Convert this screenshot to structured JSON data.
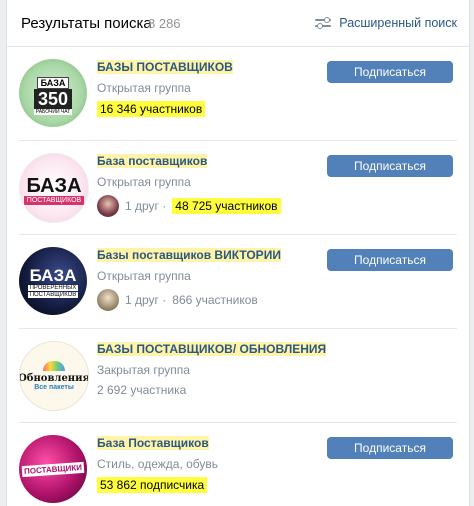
{
  "header": {
    "title": "Результаты поиска",
    "count": "8 286",
    "advanced_label": "Расширенный поиск"
  },
  "results": [
    {
      "name": "БАЗЫ ПОСТАВЩИКОВ",
      "type": "Открытая группа",
      "members": "16 346 участников",
      "friends": "",
      "button": "Подписаться",
      "avatar_lines": [
        "БАЗА",
        "350",
        "РАБОЧИЙ ЧАТ"
      ]
    },
    {
      "name": "База поставщиков",
      "type": "Открытая группа",
      "members": "48 725 участников",
      "friends": "1 друг ·",
      "button": "Подписаться",
      "avatar_lines": [
        "БАЗА",
        "ПОСТАВЩИКОВ"
      ]
    },
    {
      "name": "Базы поставщиков ВИКТОРИИ",
      "type": "Открытая группа",
      "members": "866 участников",
      "friends": "1 друг ·",
      "button": "Подписаться",
      "avatar_lines": [
        "БАЗА",
        "ПРОВЕРЕННЫХ",
        "ПОСТАВЩИКОВ"
      ]
    },
    {
      "name": "БАЗЫ ПОСТАВЩИКОВ/ ОБНОВЛЕНИЯ",
      "type": "Закрытая группа",
      "members": "2 692 участника",
      "friends": "",
      "button": "",
      "avatar_lines": [
        "Обновления",
        "Все пакеты"
      ]
    },
    {
      "name": "База Поставщиков",
      "type": "Стиль, одежда, обувь",
      "members": "53 862 подписчика",
      "friends": "",
      "button": "Подписаться",
      "avatar_lines": [
        "ПОСТАВЩИКИ"
      ]
    }
  ],
  "colors": {
    "link": "#2a5885",
    "button": "#5181b8",
    "highlight": "#fefe3c"
  }
}
